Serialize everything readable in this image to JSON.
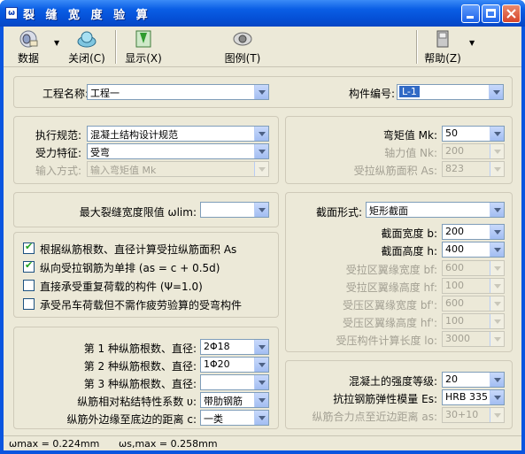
{
  "window": {
    "title": "裂 缝 宽 度 验 算",
    "app_icon": "ω"
  },
  "toolbar": {
    "data_label": "数据",
    "close_label": "关闭(C)",
    "display_label": "显示(X)",
    "legend_label": "图例(T)",
    "help_label": "帮助(Z)"
  },
  "project": {
    "name_label": "工程名称:",
    "name_value": "工程一",
    "member_label": "构件编号:",
    "member_value": "L-1"
  },
  "code": {
    "spec_label": "执行规范:",
    "spec_value": "混凝土结构设计规范",
    "force_label": "受力特征:",
    "force_value": "受弯",
    "input_label": "输入方式:",
    "input_value": "输入弯矩值 Mk"
  },
  "loads": {
    "mk_label": "弯矩值 Mk:",
    "mk_value": "50",
    "nk_label": "轴力值 Nk:",
    "nk_value": "200",
    "as_label": "受拉纵筋面积 As:",
    "as_value": "823"
  },
  "crack": {
    "limit_label": "最大裂缝宽度限值 ωlim:",
    "limit_value": ""
  },
  "options": [
    {
      "label": "根据纵筋根数、直径计算受拉纵筋面积 As",
      "checked": true
    },
    {
      "label": "纵向受拉钢筋为单排 (as = c + 0.5d)",
      "checked": true
    },
    {
      "label": "直接承受重复荷载的构件 (Ψ=1.0)",
      "checked": false
    },
    {
      "label": "承受吊车荷载但不需作疲劳验算的受弯构件",
      "checked": false
    }
  ],
  "section": {
    "shape_label": "截面形式:",
    "shape_value": "矩形截面",
    "width_label": "截面宽度 b:",
    "width_value": "200",
    "height_label": "截面高度 h:",
    "height_value": "400",
    "bf_t_label": "受拉区翼缘宽度 bf:",
    "bf_t_value": "600",
    "hf_t_label": "受拉区翼缘高度 hf:",
    "hf_t_value": "100",
    "bf_c_label": "受压区翼缘宽度 bf':",
    "bf_c_value": "600",
    "hf_c_label": "受压区翼缘高度 hf':",
    "hf_c_value": "100",
    "l0_label": "受压构件计算长度 lo:",
    "l0_value": "3000"
  },
  "rebar": {
    "r1_label": "第 1 种纵筋根数、直径:",
    "r1_value": "2Φ18",
    "r2_label": "第 2 种纵筋根数、直径:",
    "r2_value": "1Φ20",
    "r3_label": "第 3 种纵筋根数、直径:",
    "r3_value": "",
    "bond_label": "纵筋相对粘结特性系数 υ:",
    "bond_value": "带肋钢筋",
    "cover_label": "纵筋外边缘至底边的距离 c:",
    "cover_value": "一类"
  },
  "material": {
    "concrete_label": "混凝土的强度等级:",
    "concrete_value": "20",
    "es_label": "抗拉钢筋弹性模量 Es:",
    "es_value": "HRB 335",
    "as_label": "纵筋合力点至近边距离 as:",
    "as_value": "30+10"
  },
  "status": {
    "wmax": "ωmax = 0.224mm",
    "wsmax": "ωs,max = 0.258mm"
  },
  "colors": {
    "titlebar": "#0a5ee5",
    "face": "#ece9d8",
    "selection": "#316ac5"
  }
}
